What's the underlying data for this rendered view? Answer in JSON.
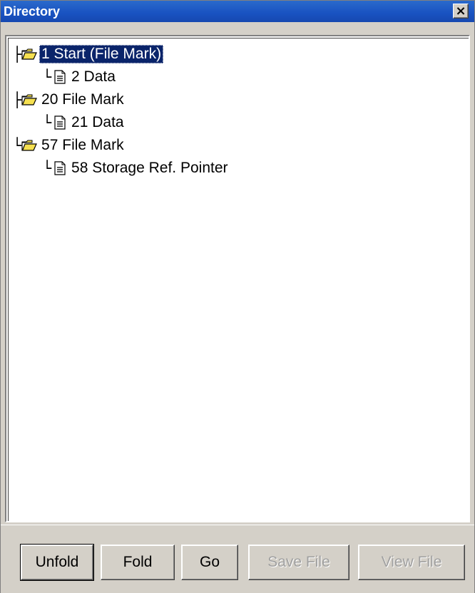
{
  "window": {
    "title": "Directory",
    "close_label": "×"
  },
  "tree": {
    "items": [
      {
        "connector": "├",
        "icon": "folder-open-icon",
        "label": "1 Start (File Mark)",
        "selected": true
      },
      {
        "connector": "└",
        "icon": "document-icon",
        "label": "2 Data",
        "selected": false
      },
      {
        "connector": "├",
        "icon": "folder-open-icon",
        "label": "20 File Mark",
        "selected": false
      },
      {
        "connector": "└",
        "icon": "document-icon",
        "label": "21 Data",
        "selected": false
      },
      {
        "connector": "└",
        "icon": "folder-open-icon",
        "label": "57 File Mark",
        "selected": false
      },
      {
        "connector": "└",
        "icon": "document-icon",
        "label": "58 Storage Ref. Pointer",
        "selected": false
      }
    ]
  },
  "buttons": {
    "unfold": "Unfold",
    "fold": "Fold",
    "go": "Go",
    "save_file": "Save File",
    "view_file": "View File"
  },
  "colors": {
    "titlebar": "#1952c1",
    "selection": "#0a246a",
    "folder": "#f5e050",
    "face": "#d4d0c8"
  }
}
